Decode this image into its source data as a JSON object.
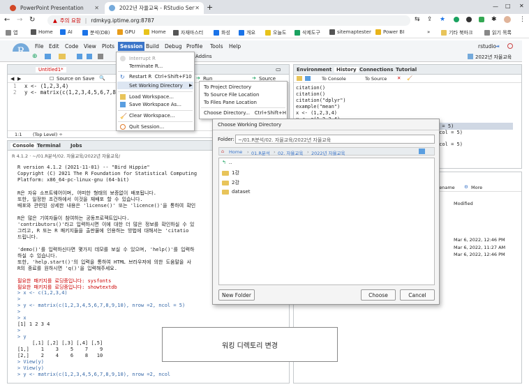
{
  "browser": {
    "tabs": [
      {
        "title": "PowerPoint Presentation"
      },
      {
        "title": "2022년 자율교육 - RStudio Serv"
      }
    ],
    "url": "rdmkyg.iptime.org:8787",
    "security_label": "주의 요함",
    "bookmarks": [
      "앱",
      "Home",
      "AI",
      "분석(DB)",
      "GPU",
      "Home",
      "자재마스터",
      "화성",
      "개요",
      "오늘도",
      "삭제도구",
      "sitemaptester",
      "Power BI",
      "기타 북마크",
      "읽기 목록"
    ]
  },
  "rstudio": {
    "menu": [
      "File",
      "Edit",
      "Code",
      "View",
      "Plots",
      "Session",
      "Build",
      "Debug",
      "Profile",
      "Tools",
      "Help"
    ],
    "user": "rstudio",
    "project": "2022년 자율교육",
    "addins": "Addins",
    "source_tab": "Untitled1*",
    "source_on_save": "Source on Save",
    "run_label": "Run",
    "source_label": "Source",
    "code": [
      {
        "n": "1",
        "text": "x <- (1,2,3,4)"
      },
      {
        "n": "2",
        "text": "y <- matrix(c(1,2,3,4,5,6,7,8"
      }
    ],
    "status_pos": "1:1",
    "status_scope": "(Top Level) ÷",
    "env_tabs": [
      "Environment",
      "History",
      "Connections",
      "Tutorial"
    ],
    "to_console": "To Console",
    "to_source": "To Source",
    "history": [
      "citation()",
      "citation()",
      "citation(\"dplyr\")",
      "example(\"mean\")",
      "x <- (1,2,3,4)",
      "x <- c(1,2,3,4)"
    ],
    "history_right": [
      "1 = 5)",
      "ncol = 5)",
      "ncol = 5)"
    ],
    "files_actions": [
      "Rename",
      "More"
    ],
    "files_modified_header": "Modified",
    "files_modified": [
      "Mar 6, 2022, 12:46 PM",
      "Mar 6, 2022, 11:27 AM",
      "Mar 6, 2022, 12:46 PM"
    ],
    "console_tabs": [
      "Console",
      "Terminal",
      "Jobs"
    ],
    "console_path": "R 4.1.2 · ~/01.R분석/02. 자율교육/2022년 자율교육/",
    "console": [
      {
        "t": "R version 4.1.2 (2021-11-01) -- \"Bird Hippie\"",
        "c": ""
      },
      {
        "t": "Copyright (C) 2021 The R Foundation for Statistical Computing",
        "c": ""
      },
      {
        "t": "Platform: x86_64-pc-linux-gnu (64-bit)",
        "c": ""
      },
      {
        "t": "",
        "c": ""
      },
      {
        "t": "R은 자유 소프트웨어이며, 어떠한 형태의 보증없이 배포됩니다.",
        "c": ""
      },
      {
        "t": "또한, 일정한 조건하에서 이것을 재배포 할 수 있습니다.",
        "c": ""
      },
      {
        "t": "배포와 관련된 상세한 내용은 'license()' 또는 'licence()'을 통하여 확인",
        "c": ""
      },
      {
        "t": "",
        "c": ""
      },
      {
        "t": "R은 많은 기여자들이 참여하는 공동프로젝트입니다.",
        "c": ""
      },
      {
        "t": "'contributors()'라고 입력하시면 이에 대한 더 많은 정보를 확인하실 수 있",
        "c": ""
      },
      {
        "t": "그리고, R 또는 R 패키지들을 출판물에 인용하는 방법에 대해서는 'citatio",
        "c": ""
      },
      {
        "t": "드립니다.",
        "c": ""
      },
      {
        "t": "",
        "c": ""
      },
      {
        "t": "'demo()'를 입력하신다면 몇가지 데모를 보실 수 있으며, 'help()'를 입력하",
        "c": ""
      },
      {
        "t": "하실 수 있습니다.",
        "c": ""
      },
      {
        "t": "또한, 'help.start()'의 입력을 통하여 HTML 브라우저에 의한 도움말을 사",
        "c": ""
      },
      {
        "t": "R의 종료를 원하시면 'q()'을 입력해주세요.",
        "c": ""
      },
      {
        "t": "",
        "c": ""
      },
      {
        "t": "필요한 패키지를 로딩중입니다: sysfonts",
        "c": "red"
      },
      {
        "t": "필요한 패키지를 로딩중입니다: showtextdb",
        "c": "red"
      },
      {
        "t": "> x <- c(1,2,3,4)",
        "c": "blue"
      },
      {
        "t": ">",
        "c": "blue"
      },
      {
        "t": "> y <- matrix(c(1,2,3,4,5,6,7,8,9,10), nrow =2, ncol = 5)",
        "c": "blue"
      },
      {
        "t": ">",
        "c": "blue"
      },
      {
        "t": "> x",
        "c": "blue"
      },
      {
        "t": "[1] 1 2 3 4",
        "c": ""
      },
      {
        "t": ">",
        "c": "blue"
      },
      {
        "t": "> y",
        "c": "blue"
      },
      {
        "t": "     [,1] [,2] [,3] [,4] [,5]",
        "c": ""
      },
      {
        "t": "[1,]    1    3    5    7    9",
        "c": ""
      },
      {
        "t": "[2,]    2    4    6    8   10",
        "c": ""
      },
      {
        "t": "> View(y)",
        "c": "blue"
      },
      {
        "t": "> View(y)",
        "c": "blue"
      },
      {
        "t": "> y <- matrix(c(1,2,3,4,5,6,7,8,9,10), nrow =2, ncol",
        "c": "blue"
      }
    ]
  },
  "session_menu": {
    "items": [
      {
        "label": "Interrupt R",
        "disabled": true
      },
      {
        "label": "Terminate R...",
        "disabled": false
      },
      {
        "label": "Restart R",
        "shortcut": "Ctrl+Shift+F10",
        "disabled": false
      },
      {
        "label": "Set Working Directory",
        "disabled": false
      },
      {
        "label": "Load Workspace...",
        "disabled": false
      },
      {
        "label": "Save Workspace As...",
        "disabled": false
      },
      {
        "label": "Clear Workspace...",
        "disabled": false
      },
      {
        "label": "Quit Session...",
        "disabled": false
      }
    ],
    "submenu": [
      {
        "label": "To Project Directory"
      },
      {
        "label": "To Source File Location"
      },
      {
        "label": "To Files Pane Location"
      },
      {
        "label": "Choose Directory...",
        "shortcut": "Ctrl+Shift+H"
      }
    ]
  },
  "dialog": {
    "title": "Choose Working Directory",
    "folder_label": "Folder:",
    "folder_value": "~/01.R분석/02. 자율교육/2022년 자율교육",
    "breadcrumb": [
      "Home",
      "01.R분석",
      "02. 자율교육",
      "2022년 자율교육"
    ],
    "parent": "..",
    "entries": [
      "1강",
      "2강",
      "dataset"
    ],
    "new_folder": "New Folder",
    "choose": "Choose",
    "cancel": "Cancel"
  },
  "caption": "워킹 디렉토리 변경"
}
